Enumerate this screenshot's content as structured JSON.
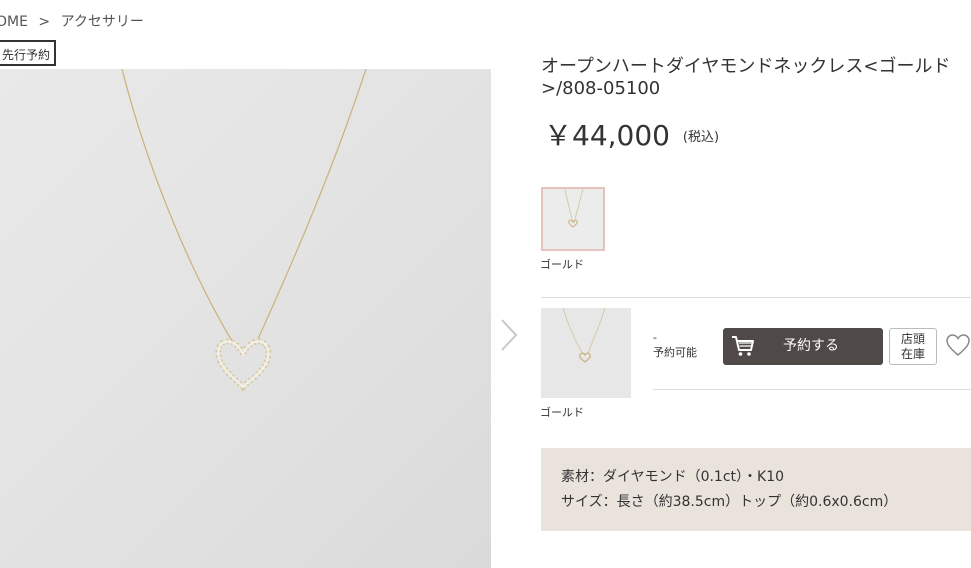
{
  "breadcrumb": {
    "home": "OME",
    "sep": ">",
    "current": "アクセサリー"
  },
  "badge": "先行予約",
  "product": {
    "title": "オープンハートダイヤモンドネックレス<ゴールド>/808-05100",
    "price": "￥44,000",
    "tax_label": "(税込)"
  },
  "colors": {
    "selected": "ゴールド"
  },
  "variant": {
    "color_label": "ゴールド",
    "stock_dash": "-",
    "stock_status": "予約可能",
    "reserve_label": "予約する",
    "store_stock_line1": "店頭",
    "store_stock_line2": "在庫"
  },
  "specs": {
    "material": "素材：ダイヤモンド（0.1ct）・K10",
    "size": "サイズ：長さ（約38.5cm）トップ（約0.6x0.6cm）"
  },
  "icons": [
    "chevron-right-icon",
    "cart-icon",
    "heart-icon"
  ],
  "theme": {
    "button_bg": "#4f4947",
    "spec_bg": "#e9e3dc",
    "swatch_border": "#e4c3bc"
  }
}
